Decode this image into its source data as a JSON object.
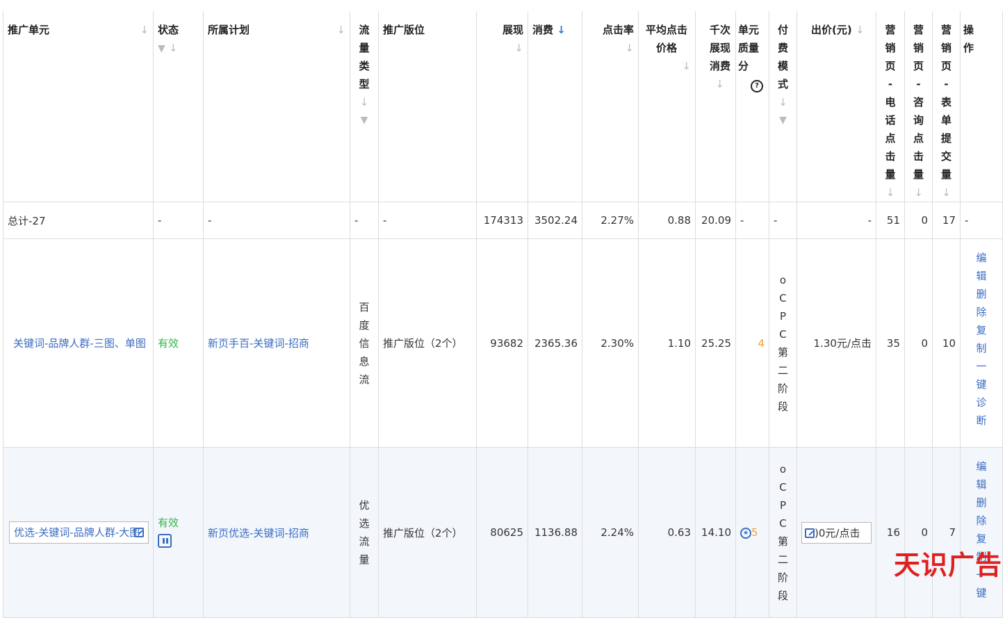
{
  "headers": {
    "unit": "推广单元",
    "status": "状态",
    "plan": "所属计划",
    "traffic_type": "流量类型",
    "placement": "推广版位",
    "impressions": "展现",
    "cost": "消费",
    "ctr": "点击率",
    "avg_cpc": "平均点击价格",
    "cpm": "千次展现消费",
    "quality": "单元质量分",
    "pay_mode": "付费模式",
    "bid": "出价(元)",
    "phone_clicks": "营销页-电话点击量",
    "consult_clicks": "营销页-咨询点击量",
    "form_submits": "营销页-表单提交量",
    "ops": "操作"
  },
  "icons": {
    "sort": "sort-arrow-icon",
    "sort_active": "sort-desc-active-icon",
    "filter": "filter-funnel-icon",
    "help": "question-help-icon"
  },
  "total_row": {
    "unit": "总计-27",
    "status": "-",
    "plan": "-",
    "traffic_type": "-",
    "placement": "-",
    "impressions": "174313",
    "cost": "3502.24",
    "ctr": "2.27%",
    "avg_cpc": "0.88",
    "cpm": "20.09",
    "quality": "-",
    "pay_mode": "-",
    "bid": "-",
    "phone_clicks": "51",
    "consult_clicks": "0",
    "form_submits": "17",
    "ops": "-"
  },
  "rows": [
    {
      "unit": "关键词-品牌人群-三图、单图",
      "status": "有效",
      "plan": "新页手百-关键词-招商",
      "traffic_type": "百度信息流",
      "placement": "推广版位（2个）",
      "impressions": "93682",
      "cost": "2365.36",
      "ctr": "2.30%",
      "avg_cpc": "1.10",
      "cpm": "25.25",
      "quality": "4",
      "pay_mode": "oCPC第二阶段",
      "bid": "1.30元/点击",
      "phone_clicks": "35",
      "consult_clicks": "0",
      "form_submits": "10",
      "ops": "编辑删除复制一键诊断"
    },
    {
      "unit": "优选-关键词-品牌人群-大图",
      "status": "有效",
      "plan": "新页优选-关键词-招商",
      "traffic_type": "优选流量",
      "placement": "推广版位（2个）",
      "impressions": "80625",
      "cost": "1136.88",
      "ctr": "2.24%",
      "avg_cpc": "0.63",
      "cpm": "14.10",
      "quality": "5",
      "pay_mode": "oCPC第二阶段",
      "bid": ")0元/点击",
      "phone_clicks": "16",
      "consult_clicks": "0",
      "form_submits": "7",
      "ops": "编辑删除复制一键"
    }
  ],
  "colors": {
    "link": "#3a6cc2",
    "status_ok": "#35b54a",
    "quality": "#f0a030",
    "watermark": "#e02020"
  },
  "watermark": "天识广告"
}
